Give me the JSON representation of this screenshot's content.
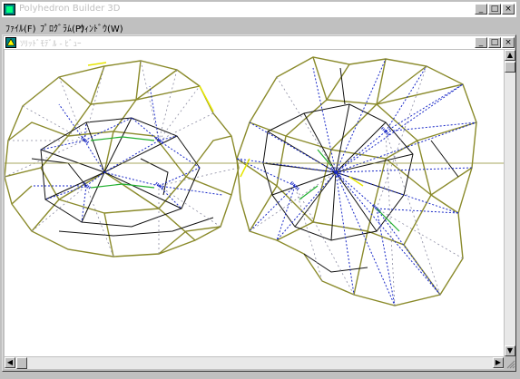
{
  "app": {
    "title": "Polyhedron Builder 3D",
    "caption_buttons": {
      "minimize": "_",
      "maximize": "□",
      "close": "×"
    }
  },
  "menu": {
    "items": [
      {
        "label": "ﾌｧｲﾙ(F)"
      },
      {
        "label": "ﾌﾟﾛｸﾞﾗﾑ(P)"
      },
      {
        "label": "ｳｨﾝﾄﾞｳ(W)"
      }
    ]
  },
  "child_window": {
    "title": "ｿﾘｯﾄﾞﾓﾃﾞﾙ - ﾋﾞｭｰ",
    "caption_buttons": {
      "minimize": "_",
      "maximize": "□",
      "close": "×"
    }
  },
  "colors": {
    "edge_olive": "#8a8a2a",
    "edge_black": "#101010",
    "inner_blue": "#1a2ac8",
    "inner_gray": "#8a8aa0",
    "accent_green": "#22b030",
    "accent_yellow": "#e6e600"
  },
  "scroll": {
    "up": "▲",
    "down": "▼",
    "left": "◀",
    "right": "▶"
  }
}
